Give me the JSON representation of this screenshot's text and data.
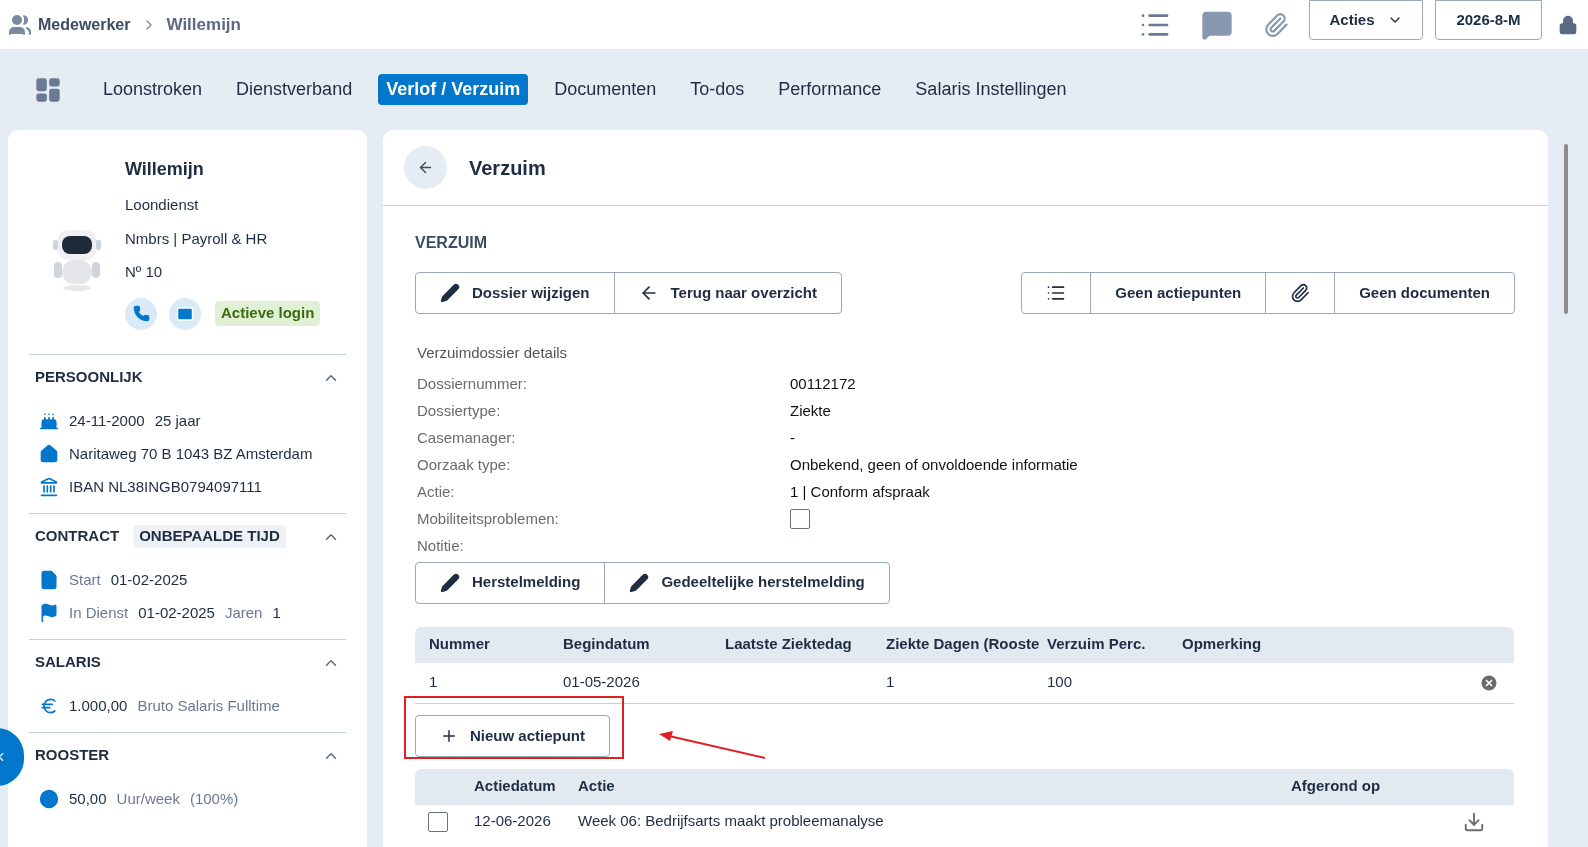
{
  "breadcrumb": {
    "section": "Medewerker",
    "current": "Willemijn"
  },
  "topbar": {
    "actions_button": "Acties",
    "period_button": "2026-8-M"
  },
  "tabs": [
    {
      "label": "Loonstroken",
      "selected": false
    },
    {
      "label": "Dienstverband",
      "selected": false
    },
    {
      "label": "Verlof / Verzuim",
      "selected": true
    },
    {
      "label": "Documenten",
      "selected": false
    },
    {
      "label": "To-dos",
      "selected": false
    },
    {
      "label": "Performance",
      "selected": false
    },
    {
      "label": "Salaris Instellingen",
      "selected": false
    }
  ],
  "profile": {
    "name": "Willemijn",
    "lines": [
      "Loondienst",
      "Nmbrs | Payroll & HR",
      "Nº 10"
    ],
    "login_badge": "Actieve login"
  },
  "sections": [
    {
      "title": "PERSOONLIJK",
      "expanded": true,
      "rows": [
        {
          "parts": [
            {
              "kind": "value",
              "text": "24-11-2000"
            },
            {
              "kind": "value",
              "text": "25 jaar"
            }
          ]
        },
        {
          "parts": [
            {
              "kind": "value",
              "text": "Naritaweg 70 B 1043 BZ Amsterdam"
            }
          ]
        },
        {
          "parts": [
            {
              "kind": "value",
              "text": "IBAN NL38INGB0794097111"
            }
          ]
        }
      ]
    },
    {
      "title": "CONTRACT",
      "badge": "ONBEPAALDE TIJD",
      "expanded": true,
      "rows": [
        {
          "parts": [
            {
              "kind": "label",
              "text": "Start"
            },
            {
              "kind": "value",
              "text": "01-02-2025"
            }
          ]
        },
        {
          "parts": [
            {
              "kind": "label",
              "text": "In Dienst"
            },
            {
              "kind": "value",
              "text": "01-02-2025"
            },
            {
              "kind": "label",
              "text": "Jaren"
            },
            {
              "kind": "value",
              "text": "1"
            }
          ]
        }
      ]
    },
    {
      "title": "SALARIS",
      "expanded": true,
      "rows": [
        {
          "parts": [
            {
              "kind": "value",
              "text": "1.000,00"
            },
            {
              "kind": "label",
              "text": "Bruto Salaris Fulltime"
            }
          ]
        }
      ]
    },
    {
      "title": "ROOSTER",
      "expanded": true,
      "rows": [
        {
          "parts": [
            {
              "kind": "value",
              "text": "50,00"
            },
            {
              "kind": "label",
              "text": "Uur/week"
            },
            {
              "kind": "label",
              "text": "(100%)"
            }
          ]
        }
      ]
    }
  ],
  "panel": {
    "title": "Verzuim",
    "section_title": "VERZUIM",
    "left_buttons": [
      "Dossier wijzigen",
      "Terug naar overzicht"
    ],
    "right_buttons": [
      "Geen actiepunten",
      "Geen documenten"
    ],
    "details_title": "Verzuimdossier details",
    "details": [
      {
        "label": "Dossiernummer:",
        "kind": "text",
        "value": "00112172"
      },
      {
        "label": "Dossiertype:",
        "kind": "text",
        "value": "Ziekte"
      },
      {
        "label": "Casemanager:",
        "kind": "text",
        "value": "-"
      },
      {
        "label": "Oorzaak type:",
        "kind": "text",
        "value": "Onbekend, geen of onvoldoende informatie"
      },
      {
        "label": "Actie:",
        "kind": "text",
        "value": "1 | Conform afspraak"
      },
      {
        "label": "Mobiliteitsproblemen:",
        "kind": "checkbox",
        "checked": false
      },
      {
        "label": "Notitie:",
        "kind": "empty"
      }
    ],
    "note_buttons": [
      "Herstelmelding",
      "Gedeeltelijke herstelmelding"
    ],
    "table": {
      "columns": [
        "Nummer",
        "Begindatum",
        "Laatste Ziektedag",
        "Ziekte Dagen (Rooste",
        "Verzuim Perc.",
        "Opmerking"
      ],
      "rows": [
        {
          "cells": [
            "1",
            "01-05-2026",
            "",
            "1",
            "100",
            ""
          ]
        }
      ]
    },
    "new_button": "Nieuw actiepunt",
    "actions_table": {
      "columns": [
        "Actiedatum",
        "Actie",
        "Afgerond op"
      ],
      "rows": [
        {
          "checked": false,
          "cells": [
            "12-06-2026",
            "Week 06: Bedrijfsarts maakt probleemanalyse",
            ""
          ]
        }
      ]
    }
  }
}
